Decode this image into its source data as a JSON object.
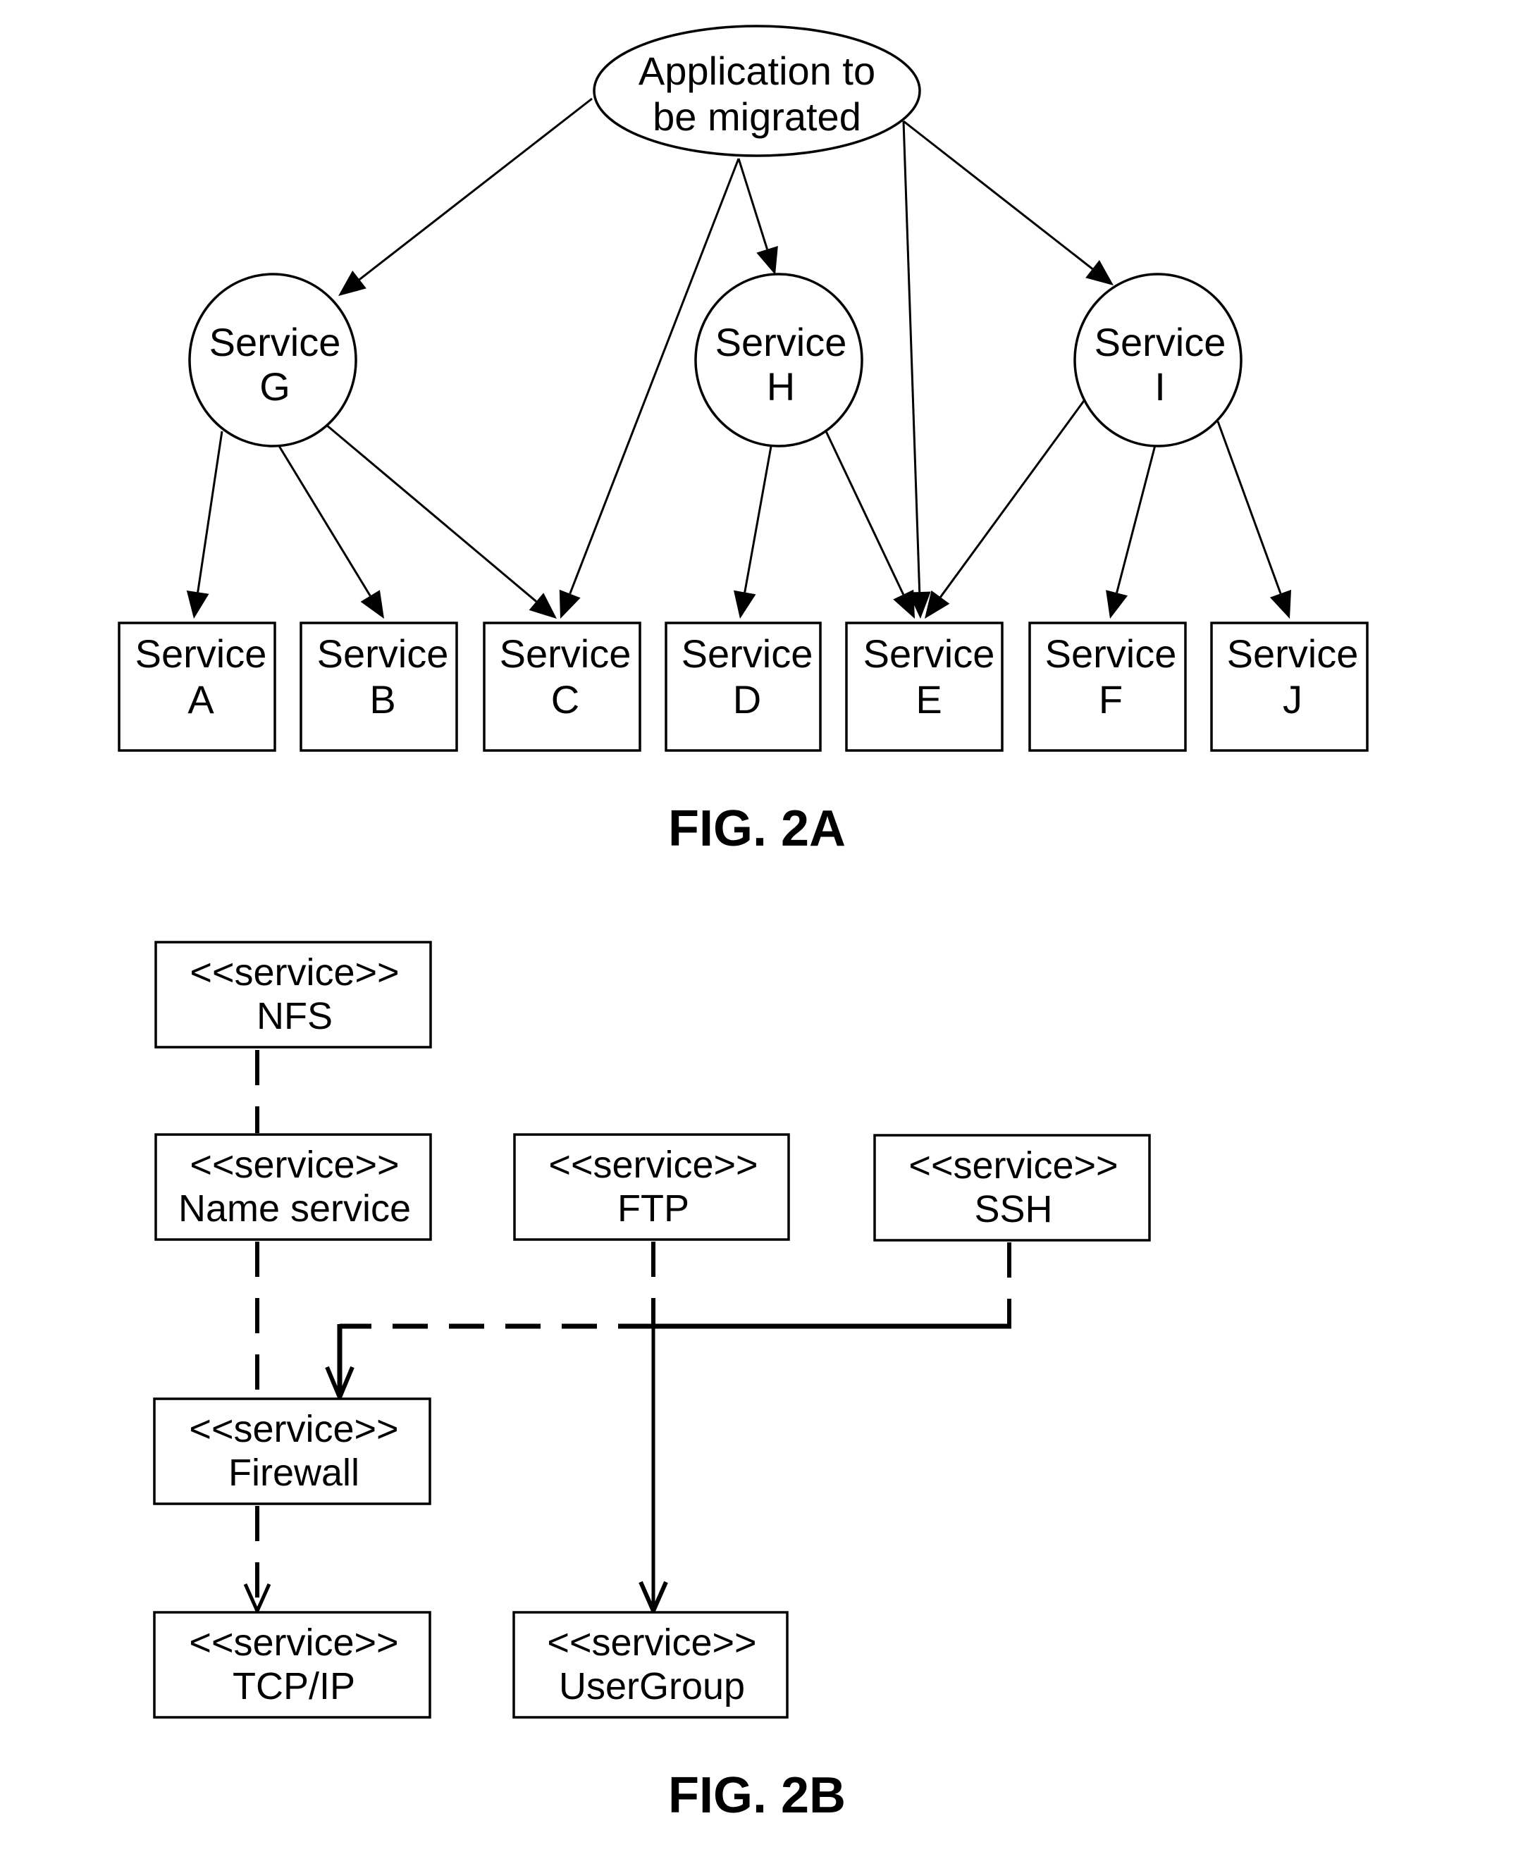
{
  "figure_2a": {
    "caption": "FIG. 2A",
    "root": {
      "id": "app",
      "line1": "Application to",
      "line2": "be migrated"
    },
    "intermediate_nodes": [
      {
        "id": "G",
        "line1": "Service",
        "line2": "G"
      },
      {
        "id": "H",
        "line1": "Service",
        "line2": "H"
      },
      {
        "id": "I",
        "line1": "Service",
        "line2": "I"
      }
    ],
    "leaf_nodes": [
      {
        "id": "A",
        "line1": "Service",
        "line2": "A"
      },
      {
        "id": "B",
        "line1": "Service",
        "line2": "B"
      },
      {
        "id": "C",
        "line1": "Service",
        "line2": "C"
      },
      {
        "id": "D",
        "line1": "Service",
        "line2": "D"
      },
      {
        "id": "E",
        "line1": "Service",
        "line2": "E"
      },
      {
        "id": "F",
        "line1": "Service",
        "line2": "F"
      },
      {
        "id": "J",
        "line1": "Service",
        "line2": "J"
      }
    ],
    "edges": [
      {
        "from": "app",
        "to": "G"
      },
      {
        "from": "app",
        "to": "C"
      },
      {
        "from": "app",
        "to": "H"
      },
      {
        "from": "app",
        "to": "E"
      },
      {
        "from": "app",
        "to": "I"
      },
      {
        "from": "G",
        "to": "A"
      },
      {
        "from": "G",
        "to": "B"
      },
      {
        "from": "G",
        "to": "C"
      },
      {
        "from": "H",
        "to": "D"
      },
      {
        "from": "H",
        "to": "E"
      },
      {
        "from": "I",
        "to": "E"
      },
      {
        "from": "I",
        "to": "F"
      },
      {
        "from": "I",
        "to": "J"
      }
    ]
  },
  "figure_2b": {
    "caption": "FIG. 2B",
    "stereotype": "<<service>>",
    "nodes": [
      {
        "id": "nfs",
        "stereotype": "<<service>>",
        "name": "NFS"
      },
      {
        "id": "name",
        "stereotype": "<<service>>",
        "name": "Name service"
      },
      {
        "id": "ftp",
        "stereotype": "<<service>>",
        "name": "FTP"
      },
      {
        "id": "ssh",
        "stereotype": "<<service>>",
        "name": "SSH"
      },
      {
        "id": "firewall",
        "stereotype": "<<service>>",
        "name": "Firewall"
      },
      {
        "id": "tcpip",
        "stereotype": "<<service>>",
        "name": "TCP/IP"
      },
      {
        "id": "usergroup",
        "stereotype": "<<service>>",
        "name": "UserGroup"
      }
    ],
    "edges": [
      {
        "from": "nfs",
        "to": "name",
        "style": "dashed"
      },
      {
        "from": "name",
        "to": "firewall",
        "style": "dashed"
      },
      {
        "from": "firewall",
        "to": "tcpip",
        "style": "dashed"
      },
      {
        "from": "ftp",
        "to": "firewall",
        "style": "dashed"
      },
      {
        "from": "ssh",
        "to": "firewall",
        "style": "dashed"
      },
      {
        "from": "ftp",
        "to": "usergroup",
        "style": "solid"
      },
      {
        "from": "ssh",
        "to": "usergroup",
        "style": "solid"
      }
    ]
  }
}
